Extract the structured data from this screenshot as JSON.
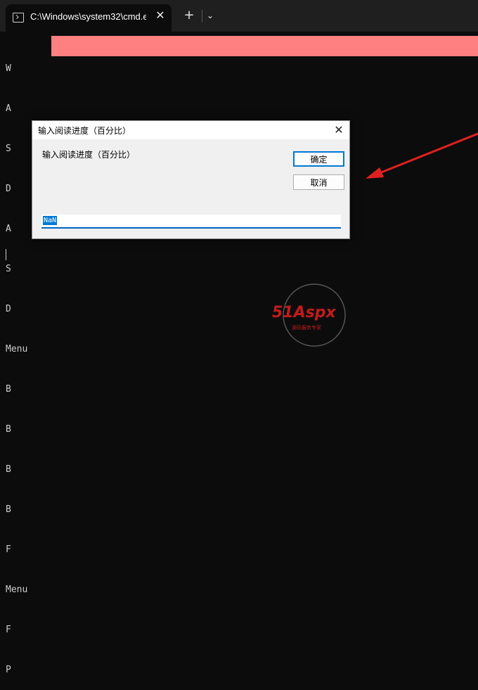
{
  "window": {
    "tab_title": "C:\\Windows\\system32\\cmd.e:",
    "tab_close": "✕",
    "new_tab": "+",
    "dropdown": "⌄"
  },
  "console": {
    "lines": [
      "W",
      "A",
      "S",
      "D",
      "A",
      "S",
      "D",
      "Menu",
      "B",
      "B",
      "B",
      "B",
      "F",
      "Menu",
      "F",
      "P"
    ],
    "progress_color": "#ff8080"
  },
  "dialog": {
    "title": "输入阅读进度（百分比）",
    "prompt": "输入阅读进度（百分比）",
    "ok_label": "确定",
    "cancel_label": "取消",
    "input_value": "NaN",
    "close": "✕"
  },
  "watermark": {
    "brand": "51Aspx",
    "sub": "源码服务专家"
  },
  "colors": {
    "accent": "#0078d4",
    "arrow": "#e02020"
  }
}
